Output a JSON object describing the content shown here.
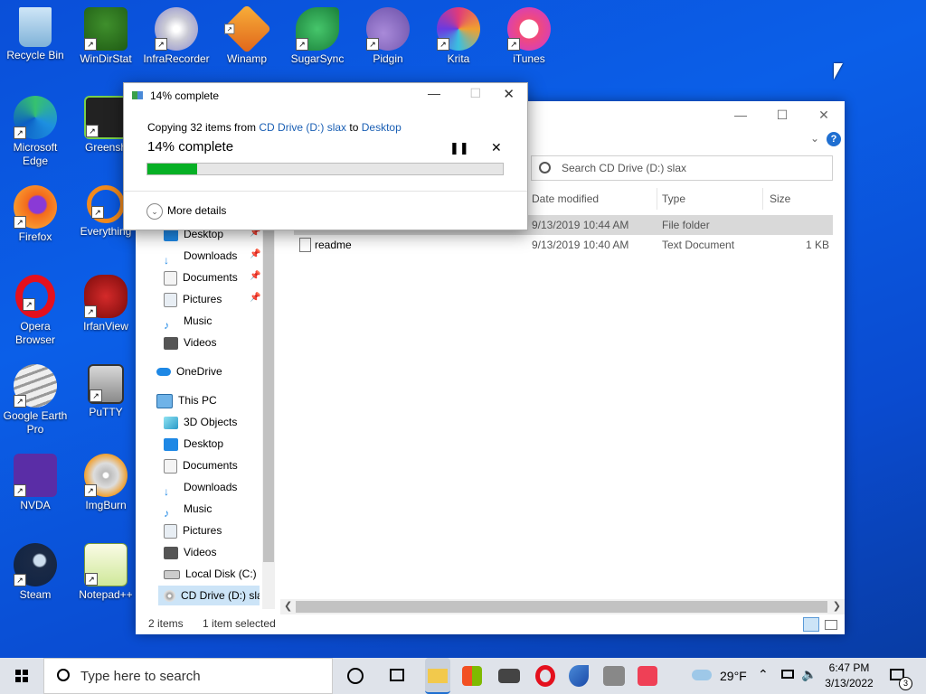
{
  "desktop": {
    "icons": [
      {
        "label": "Recycle Bin"
      },
      {
        "label": "WinDirStat"
      },
      {
        "label": "InfraRecorder"
      },
      {
        "label": "Winamp"
      },
      {
        "label": "SugarSync"
      },
      {
        "label": "Pidgin"
      },
      {
        "label": "Krita"
      },
      {
        "label": "iTunes"
      },
      {
        "label": "Microsoft Edge"
      },
      {
        "label": "Greensh"
      },
      {
        "label": "Firefox"
      },
      {
        "label": "Everything"
      },
      {
        "label": "Opera Browser"
      },
      {
        "label": "IrfanView"
      },
      {
        "label": "Google Earth Pro"
      },
      {
        "label": "PuTTY"
      },
      {
        "label": "NVDA"
      },
      {
        "label": "ImgBurn"
      },
      {
        "label": "Steam"
      },
      {
        "label": "Notepad++"
      }
    ]
  },
  "copy_dialog": {
    "title": "14% complete",
    "copying_prefix": "Copying 32 items from ",
    "source": "CD Drive (D:) slax",
    "to": " to ",
    "destination": "Desktop",
    "percent_text": "14% complete",
    "progress": 0.14,
    "more_details": "More details"
  },
  "explorer": {
    "search_placeholder": "Search CD Drive (D:) slax",
    "columns": {
      "date": "Date modified",
      "type": "Type",
      "size": "Size"
    },
    "rows": [
      {
        "name": "",
        "date": "9/13/2019 10:44 AM",
        "type": "File folder",
        "size": ""
      },
      {
        "name": "readme",
        "date": "9/13/2019 10:40 AM",
        "type": "Text Document",
        "size": "1 KB"
      }
    ],
    "nav": {
      "quick": [
        "Desktop",
        "Downloads",
        "Documents",
        "Pictures",
        "Music",
        "Videos"
      ],
      "onedrive": "OneDrive",
      "thispc": "This PC",
      "pc_items": [
        "3D Objects",
        "Desktop",
        "Documents",
        "Downloads",
        "Music",
        "Pictures",
        "Videos",
        "Local Disk (C:)",
        "CD Drive (D:) sla"
      ]
    },
    "status_items": "2 items",
    "status_selected": "1 item selected"
  },
  "taskbar": {
    "search_placeholder": "Type here to search",
    "weather": "29°F",
    "time": "6:47 PM",
    "date": "3/13/2022",
    "notification_count": "3"
  }
}
